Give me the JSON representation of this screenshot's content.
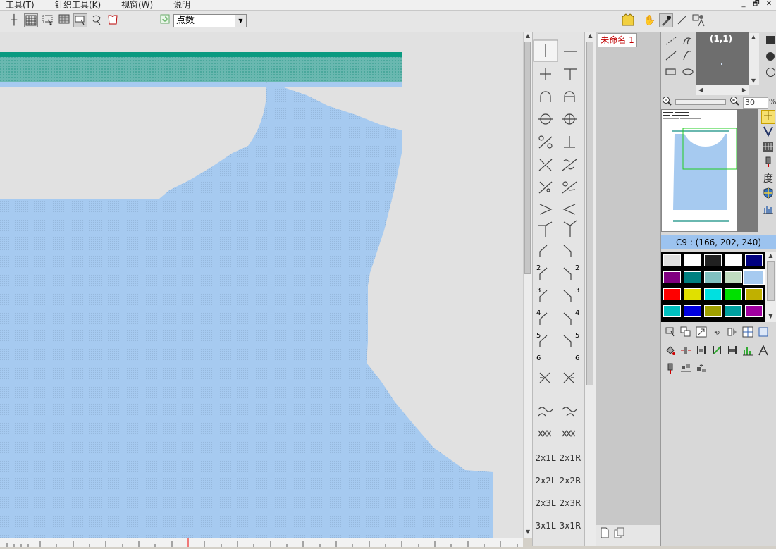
{
  "menu": {
    "items": [
      "工具(T)",
      "针织工具(K)",
      "视窗(W)",
      "说明"
    ]
  },
  "window_controls": [
    "_",
    "🗗",
    "✕"
  ],
  "toolbar": {
    "mode_select_value": "点数"
  },
  "stitch_palette": {
    "text_labels": [
      [
        "2x1L",
        "2x1R"
      ],
      [
        "2x2L",
        "2x2R"
      ],
      [
        "2x3L",
        "2x3R"
      ],
      [
        "3x1L",
        "3x1R"
      ]
    ],
    "numbered_labels": [
      "2",
      "2",
      "3",
      "3",
      "4",
      "4",
      "5",
      "5",
      "6",
      "6"
    ]
  },
  "document": {
    "tab_label": "未命名 1"
  },
  "zoom_preview": {
    "coords": "(1,1)"
  },
  "zoom_bar": {
    "value": "30",
    "unit": "%"
  },
  "side_tools": {
    "degree_label": "度"
  },
  "color": {
    "current_label": "C9 : (166, 202, 240)",
    "swatches": [
      [
        "#e0e0e0",
        "#ffffff",
        "#202020",
        "#ffffff",
        "#000080"
      ],
      [
        "#800080",
        "#008080",
        "#80c0c0",
        "#c0dcc0",
        "#a6caf0"
      ],
      [
        "#ff0000",
        "#e0e000",
        "#00e0e0",
        "#00e000",
        "#c0b000"
      ],
      [
        "#00c0c0",
        "#0000e0",
        "#a0a000",
        "#00a0a0",
        "#a000a0"
      ]
    ]
  },
  "colors": {
    "garment": "#a6caf0",
    "rib_dark": "#0a9a80",
    "rib_light": "#6ab8b0",
    "canvas_bg": "#e1e1e1"
  }
}
